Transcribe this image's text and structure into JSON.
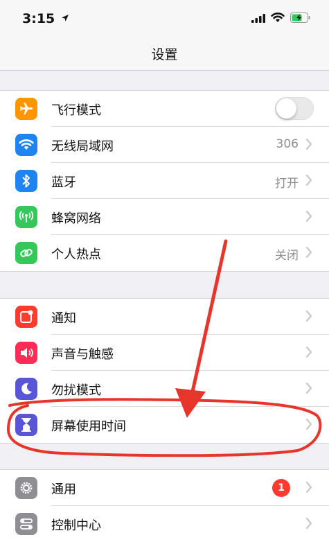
{
  "status_bar": {
    "time": "3:15"
  },
  "nav": {
    "title": "设置"
  },
  "group1": [
    {
      "label": "飞行模式",
      "icon": "airplane-icon",
      "color": "#ff9500",
      "accessory": "toggle",
      "toggle_on": false
    },
    {
      "label": "无线局域网",
      "icon": "wifi-icon",
      "color": "#1f84f2",
      "value": "306"
    },
    {
      "label": "蓝牙",
      "icon": "bluetooth-icon",
      "color": "#1f84f2",
      "value": "打开"
    },
    {
      "label": "蜂窝网络",
      "icon": "cellular-antenna-icon",
      "color": "#34c759",
      "value": ""
    },
    {
      "label": "个人热点",
      "icon": "hotspot-link-icon",
      "color": "#34c759",
      "value": "关闭"
    }
  ],
  "group2": [
    {
      "label": "通知",
      "icon": "notifications-icon",
      "color": "#ff3b30"
    },
    {
      "label": "声音与触感",
      "icon": "speaker-icon",
      "color": "#ff2d55"
    },
    {
      "label": "勿扰模式",
      "icon": "moon-icon",
      "color": "#5856d6"
    },
    {
      "label": "屏幕使用时间",
      "icon": "hourglass-icon",
      "color": "#5856d6"
    }
  ],
  "group3": [
    {
      "label": "通用",
      "icon": "gear-icon",
      "color": "#8e8e93",
      "badge": "1"
    },
    {
      "label": "控制中心",
      "icon": "control-center-icon",
      "color": "#8e8e93"
    }
  ],
  "colors": {
    "annotation": "#e8352b",
    "chevron": "#c7c7cc"
  }
}
